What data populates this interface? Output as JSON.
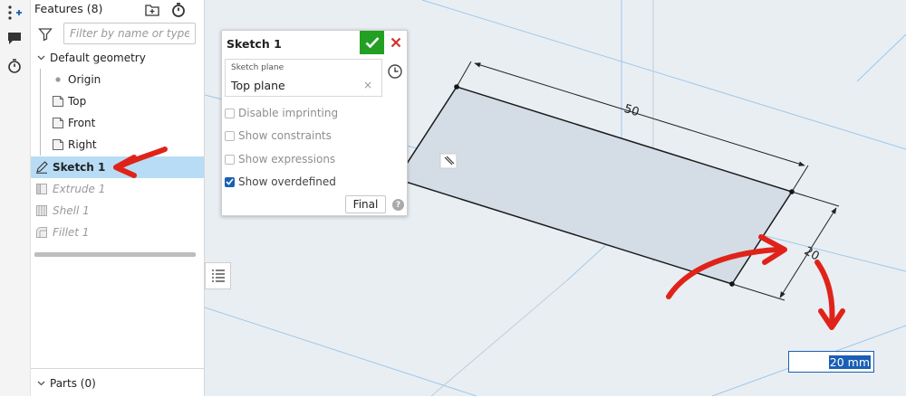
{
  "feature_panel": {
    "title": "Features (8)",
    "filter_placeholder": "Filter by name or type",
    "default_geometry_label": "Default geometry",
    "items": [
      {
        "label": "Origin"
      },
      {
        "label": "Top"
      },
      {
        "label": "Front"
      },
      {
        "label": "Right"
      },
      {
        "label": "Sketch 1"
      },
      {
        "label": "Extrude 1"
      },
      {
        "label": "Shell 1"
      },
      {
        "label": "Fillet 1"
      }
    ],
    "parts_label": "Parts (0)"
  },
  "sketch_dialog": {
    "title": "Sketch 1",
    "plane_label": "Sketch plane",
    "plane_value": "Top plane",
    "plane_clear": "×",
    "options": [
      {
        "label": "Disable imprinting",
        "checked": false
      },
      {
        "label": "Show constraints",
        "checked": false
      },
      {
        "label": "Show expressions",
        "checked": false
      },
      {
        "label": "Show overdefined",
        "checked": true
      }
    ],
    "final_label": "Final",
    "help_label": "?"
  },
  "viewport": {
    "dimension_length": "50",
    "dimension_width": "20",
    "dimension_input_value": "20 mm"
  },
  "icons": {
    "toolstrip": [
      "insert-feature-icon",
      "comment-icon",
      "timer-icon"
    ],
    "header": [
      "add-folder-icon",
      "rollback-timer-icon"
    ]
  },
  "colors": {
    "selection_highlight": "#b8dcf5",
    "accept_green": "#23a023",
    "cancel_red": "#d0312d",
    "annotation_red": "#e0231a",
    "input_blue": "#1a5fb4",
    "viewport_bg": "#e9eef3"
  }
}
